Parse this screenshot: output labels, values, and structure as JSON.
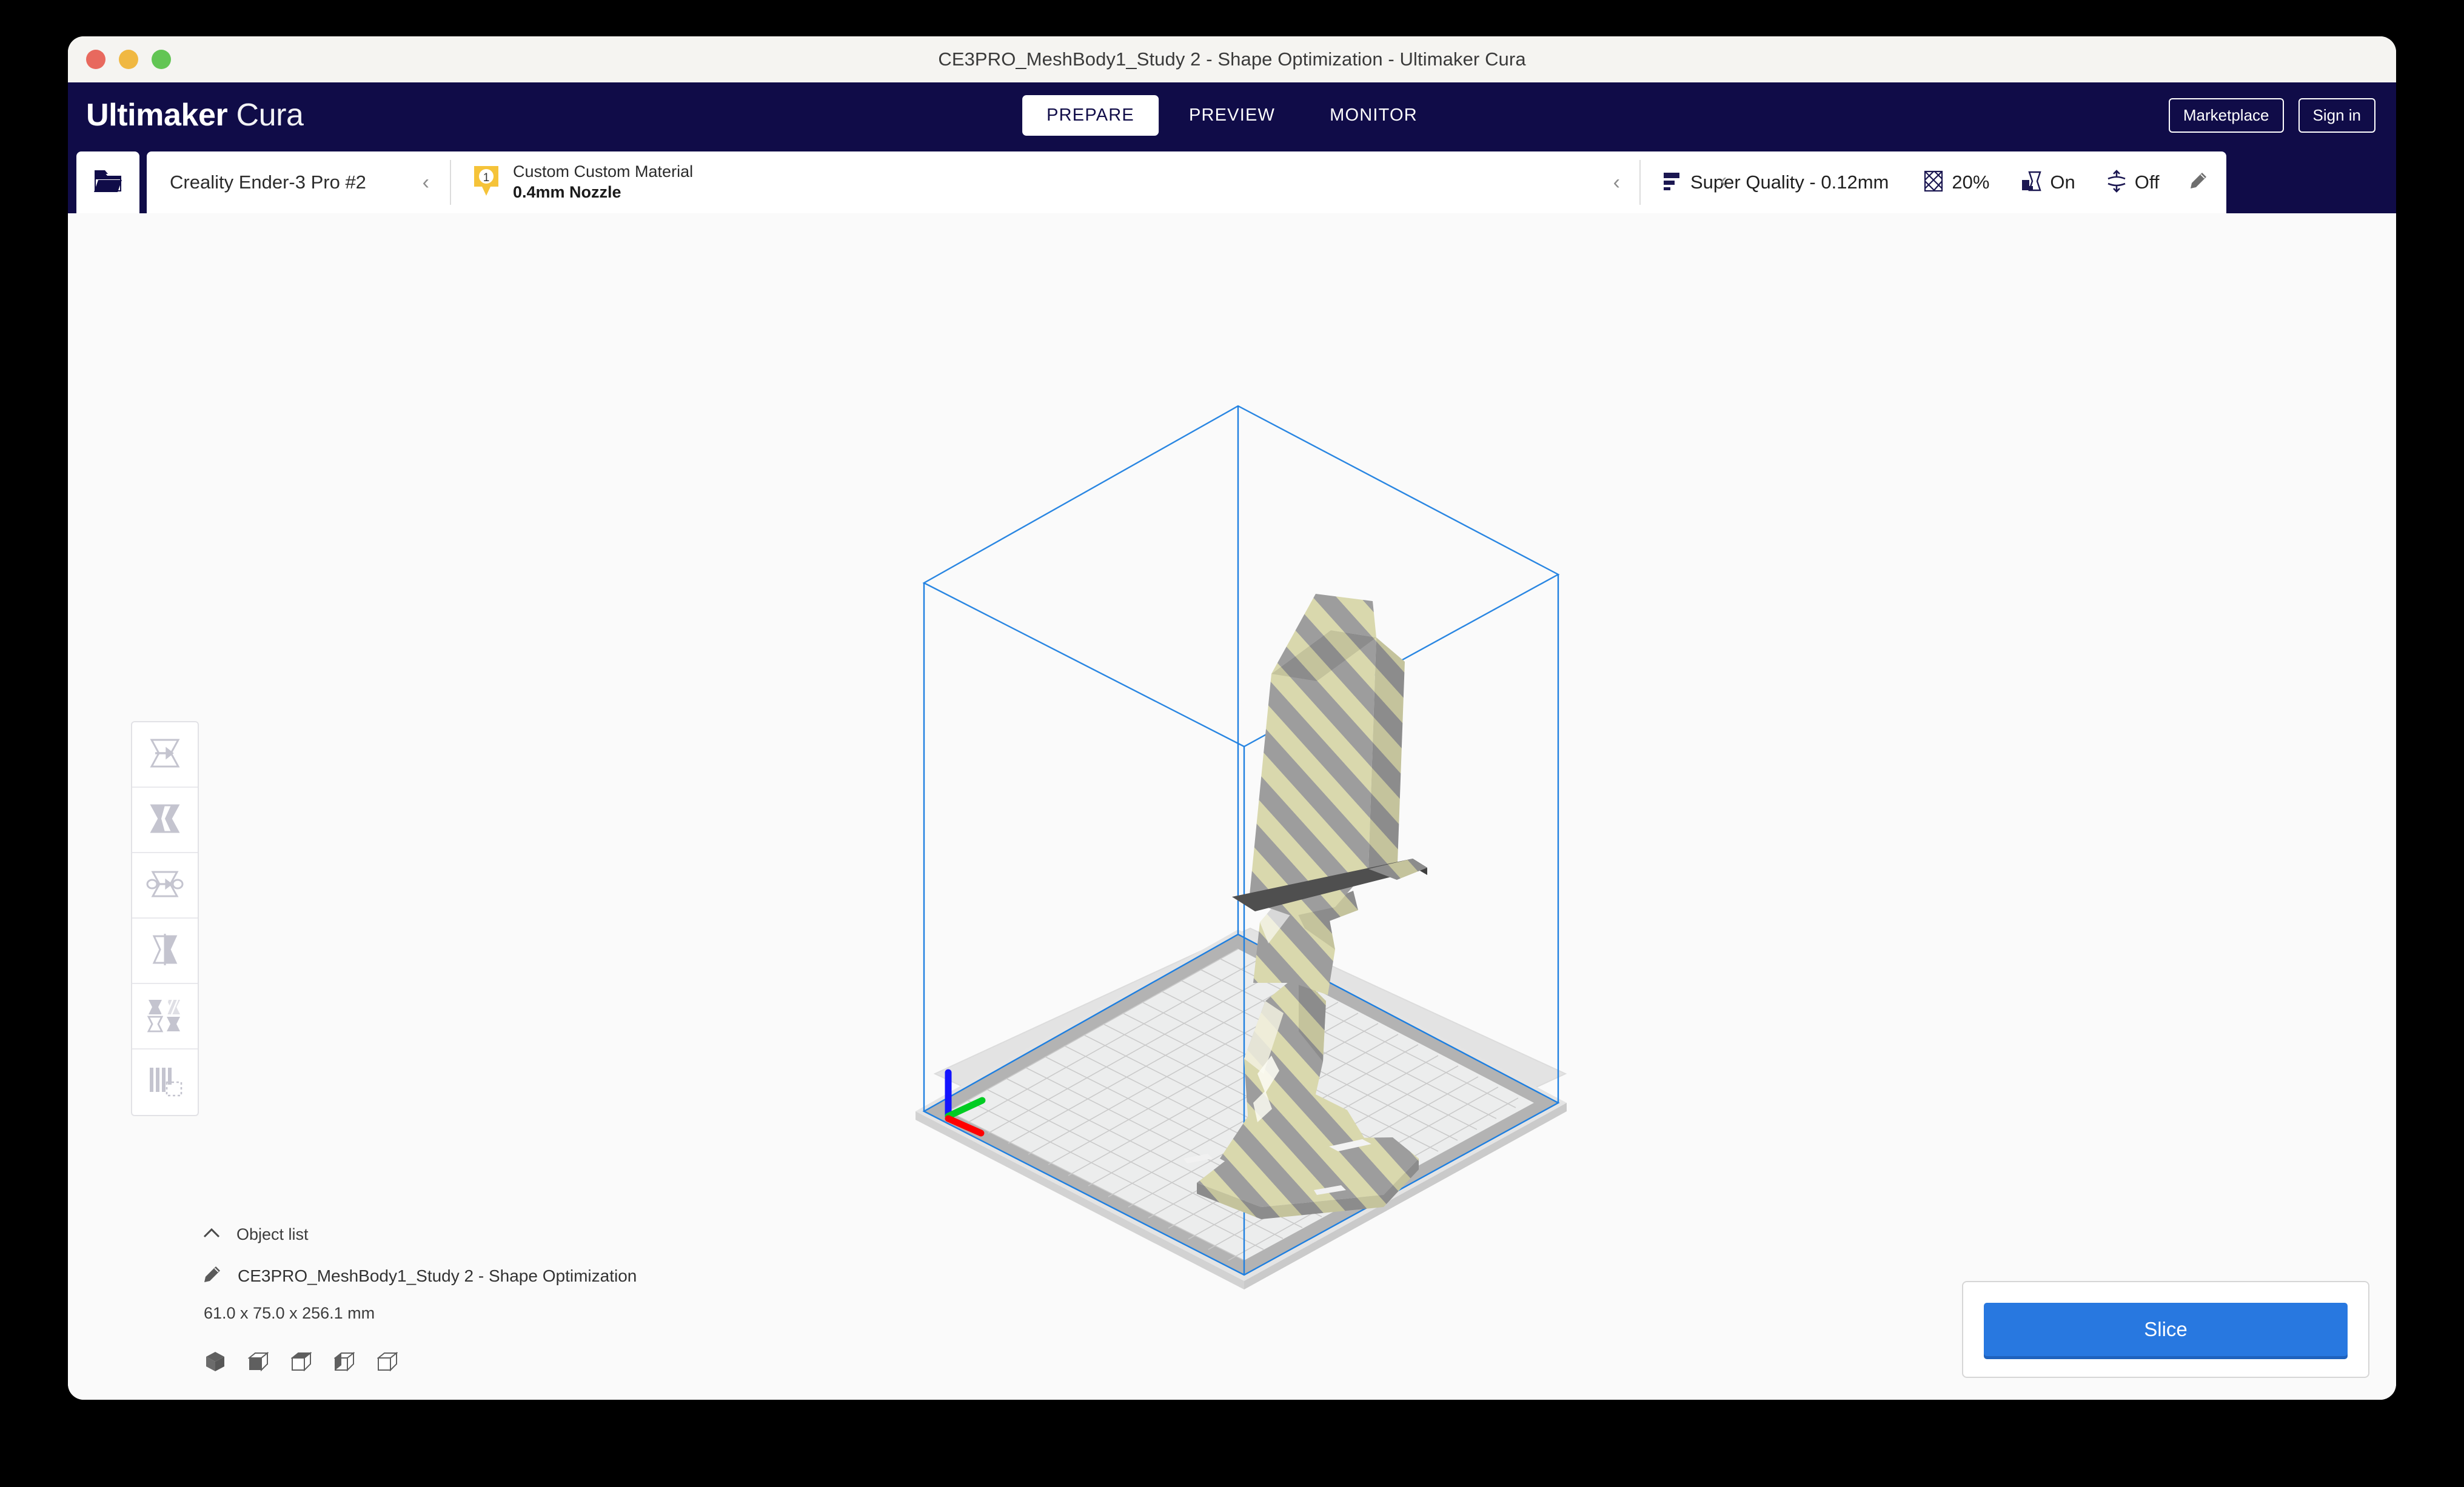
{
  "window": {
    "title": "CE3PRO_MeshBody1_Study 2 - Shape Optimization - Ultimaker Cura",
    "traffic_lights": [
      "close",
      "minimize",
      "maximize"
    ]
  },
  "header": {
    "brand_bold": "Ultimaker",
    "brand_light": "Cura",
    "tabs": [
      {
        "label": "PREPARE",
        "active": true
      },
      {
        "label": "PREVIEW",
        "active": false
      },
      {
        "label": "MONITOR",
        "active": false
      }
    ],
    "marketplace_label": "Marketplace",
    "signin_label": "Sign in"
  },
  "config_bar": {
    "open_file_icon": "folder-open-icon",
    "printer": {
      "name": "Creality Ender-3 Pro #2",
      "collapse_icon": "chevron-left-icon"
    },
    "material": {
      "extruder_number": "1",
      "name": "Custom Custom Material",
      "nozzle": "0.4mm Nozzle",
      "collapse_icon": "chevron-left-icon"
    },
    "print_settings": {
      "quality_icon": "layer-height-icon",
      "quality": "Super Quality - 0.12mm",
      "infill_icon": "infill-icon",
      "infill": "20%",
      "support_icon": "support-icon",
      "support": "On",
      "adhesion_icon": "adhesion-icon",
      "adhesion": "Off",
      "edit_icon": "pencil-icon"
    }
  },
  "tools": [
    {
      "name": "move-tool",
      "icon": "move-icon"
    },
    {
      "name": "scale-tool",
      "icon": "scale-icon"
    },
    {
      "name": "rotate-tool",
      "icon": "rotate-icon"
    },
    {
      "name": "mirror-tool",
      "icon": "mirror-icon"
    },
    {
      "name": "per-model-settings-tool",
      "icon": "per-model-settings-icon"
    },
    {
      "name": "support-blocker-tool",
      "icon": "support-blocker-icon"
    }
  ],
  "object_list": {
    "collapse_icon": "chevron-up-icon",
    "title": "Object list",
    "item_icon": "pencil-icon",
    "item_name": "CE3PRO_MeshBody1_Study 2 - Shape Optimization",
    "dimensions": "61.0 x 75.0 x 256.1 mm",
    "mesh_type_icons": [
      "cube-normal-icon",
      "cube-print-as-support-icon",
      "cube-modify-settings-icon",
      "cube-dont-support-overlap-icon",
      "cube-infill-mesh-icon"
    ]
  },
  "action_panel": {
    "slice_label": "Slice"
  },
  "viewport": {
    "model_name": "CE3PRO_MeshBody1_Study 2 - Shape Optimization",
    "model_stripe_color_a": "#d9d8ad",
    "model_stripe_color_b": "#9d9d9d",
    "buildplate_color": "#e7e7e7",
    "buildplate_grid_color": "#c9c9c9",
    "disallowed_area_color": "#b0b0b0",
    "build_volume_outline_color": "#1e7fe0",
    "axis_x_color": "#ff0000",
    "axis_y_color": "#00cc22",
    "axis_z_color": "#1414ff",
    "background_color": "#fafafa"
  },
  "theme": {
    "navy": "#100c48",
    "accent_blue": "#2878e0",
    "yellow_badge": "#f5c339",
    "window_bg": "#fafafa"
  }
}
